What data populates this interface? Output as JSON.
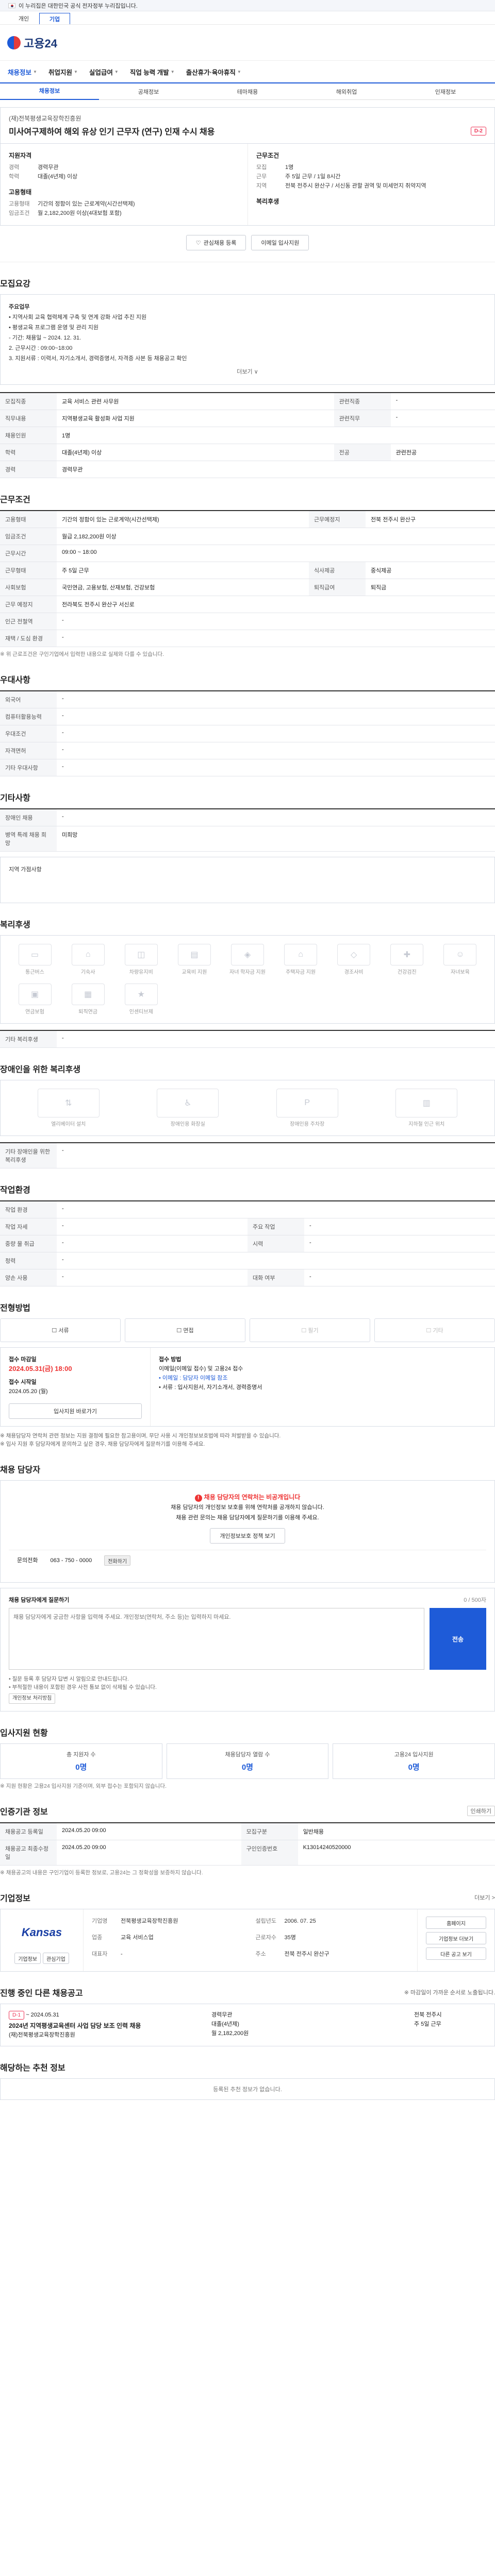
{
  "gov_banner": {
    "text": "이 누리집은 대한민국 공식 전자정부 누리집입니다."
  },
  "site_tabs": [
    {
      "label": "개인"
    },
    {
      "label": "기업"
    }
  ],
  "logo": {
    "text": "고용24"
  },
  "nav": [
    {
      "label": "채용정보"
    },
    {
      "label": "취업지원"
    },
    {
      "label": "실업급여"
    },
    {
      "label": "직업 능력 개발"
    },
    {
      "label": "출산휴가·육아휴직"
    }
  ],
  "subnav": [
    {
      "label": "채용정보"
    },
    {
      "label": "공채정보"
    },
    {
      "label": "테마채용"
    },
    {
      "label": "해외취업"
    },
    {
      "label": "인재정보"
    }
  ],
  "job": {
    "company": "(재)전북평생교육장학진흥원",
    "title": "미사여구제하여 해외 유상 인기 근무자 (연구) 인재 수시 채용",
    "dday": "D-2"
  },
  "summary": {
    "left_h1": "지원자격",
    "left_rows": [
      {
        "k": "경력",
        "v": "경력무관"
      },
      {
        "k": "학력",
        "v": "대졸(4년제) 이상"
      }
    ],
    "left_h2": "고용형태",
    "left_rows2": [
      {
        "k": "고용형태",
        "v": "기간의 정함이 있는 근로계약(시간선택제)"
      },
      {
        "k": "임금조건",
        "v": "월 2,182,200원 이상(4대보험 포함)"
      }
    ],
    "right_h1": "근무조건",
    "right_rows": [
      {
        "k": "모집",
        "v": "1명"
      },
      {
        "k": "근무",
        "v": "주 5일 근무 / 1일 8시간"
      },
      {
        "k": "지역",
        "v": "전북 전주시 완산구 / 서신동 관할 권역 및 미세먼지 취약지역"
      }
    ],
    "right_h2": "복리후생",
    "right_rows2": []
  },
  "actions": {
    "favorite": "관심채용 등록",
    "apply": "이메일 입사지원"
  },
  "sections": {
    "recruit": "모집요강",
    "conditions": "근무조건",
    "qualifications": "우대사항",
    "other": "기타사항",
    "welfare": "복리후생",
    "disability": "장애인을 위한 복리후생",
    "benefits": "기타 복리후생",
    "env": "작업환경",
    "process": "전형방법",
    "contact": "채용 담당자",
    "inquiry": "채용 담당자에게 질문하기",
    "status": "입사지원 현황",
    "info": "인증기관 정보",
    "company": "기업정보",
    "other_jobs": "진행 중인 다른 채용공고",
    "similar": "해당하는 추천 정보"
  },
  "recruit_box": {
    "heading": "주요업무",
    "lines": [
      "• 지역사회 교육 협력체계 구축 및 연계 강화 사업 추진 지원",
      "• 평생교육 프로그램 운영 및 관리 지원",
      "- 기간: 채용일 ~ 2024. 12. 31.",
      "2. 근무시간 : 09:00~18:00",
      "3. 지원서류 : 이력서, 자기소개서, 경력증명서, 자격증 사본 등 채용공고 확인"
    ],
    "more": "더보기 ∨"
  },
  "conditions_table": [
    {
      "k": "모집직종",
      "v": "교육 서비스 관련 사무원",
      "k2": "관련직종",
      "v2": "-"
    },
    {
      "k": "직무내용",
      "v": "지역평생교육 활성화 사업 지원",
      "k2": "관련직무",
      "v2": "-"
    },
    {
      "k": "채용인원",
      "v": "1명",
      "k2": "",
      "v2": ""
    },
    {
      "k": "학력",
      "v": "대졸(4년제) 이상",
      "k2": "전공",
      "v2": "관련전공"
    },
    {
      "k": "경력",
      "v": "경력무관",
      "k2": "",
      "v2": ""
    }
  ],
  "work_table": [
    {
      "k": "고용형태",
      "v": "기간의 정함이 있는 근로계약(시간선택제)",
      "k2": "근무예정지",
      "v2": "전북 전주시 완산구"
    },
    {
      "k": "임금조건",
      "v": "월급 2,182,200원 이상",
      "k2": "",
      "v2": ""
    },
    {
      "k": "근무시간",
      "v": "09:00 ~ 18:00",
      "k2": "",
      "v2": ""
    },
    {
      "k": "근무형태",
      "v": "주 5일 근무",
      "k2": "식사제공",
      "v2": "중식제공"
    },
    {
      "k": "사회보험",
      "v": "국민연금, 고용보험, 산재보험, 건강보험",
      "k2": "퇴직급여",
      "v2": "퇴직금"
    },
    {
      "k": "근무 예정지",
      "v": "전라북도 전주시 완산구 서신로",
      "k2": "",
      "v2": ""
    },
    {
      "k": "인근 전철역",
      "v": "-",
      "k2": "",
      "v2": ""
    },
    {
      "k": "재택 / 도심 환경",
      "v": "-",
      "k2": "",
      "v2": ""
    }
  ],
  "work_note": "※ 위 근로조건은 구인기업에서 입력한 내용으로 실제와 다를 수 있습니다.",
  "qual_table": [
    {
      "k": "외국어",
      "v": "-"
    },
    {
      "k": "컴퓨터활용능력",
      "v": "-"
    },
    {
      "k": "우대조건",
      "v": "-"
    },
    {
      "k": "자격면허",
      "v": "-"
    },
    {
      "k": "기타 우대사항",
      "v": "-"
    }
  ],
  "other_table": [
    {
      "k": "장애인 채용",
      "v": "-"
    },
    {
      "k": "병역 특례 채용 희망",
      "v": "미희망"
    }
  ],
  "other_note": "지역 가점사항",
  "welfare_items": [
    "통근버스",
    "기숙사",
    "차량유지비",
    "교육비 지원",
    "자녀 학자금 지원",
    "주택자금 지원",
    "경조사비",
    "건강검진",
    "자녀보육"
  ],
  "welfare_items2": [
    "연금보험",
    "퇴직연금",
    "인센티브제"
  ],
  "benefits_table": [
    {
      "k": "기타 복리후생",
      "v": "-"
    }
  ],
  "disability_items": [
    "엘리베이터 설치",
    "장애인용 화장실",
    "장애인용 주차장",
    "지하철 인근 위치"
  ],
  "disability_table": [
    {
      "k": "기타 장애인을 위한 복리후생",
      "v": "-"
    }
  ],
  "env_table": [
    {
      "k": "작업 환경",
      "v": "-",
      "k2": "",
      "v2": ""
    },
    {
      "k": "작업 자세",
      "v": "-",
      "k2": "주요 작업",
      "v2": "-"
    },
    {
      "k": "중량 물 취급",
      "v": "-",
      "k2": "시력",
      "v2": "-"
    },
    {
      "k": "청력",
      "v": "-",
      "k2": "",
      "v2": ""
    },
    {
      "k": "양손 사용",
      "v": "-",
      "k2": "대화 여부",
      "v2": "-"
    }
  ],
  "process_steps": [
    {
      "label": "서류",
      "off": false
    },
    {
      "label": "면접",
      "off": false
    },
    {
      "label": "필기",
      "off": true
    },
    {
      "label": "기타",
      "off": true
    }
  ],
  "apply": {
    "deadline_label": "접수 마감일",
    "deadline": "2024.05.31(금) 18:00",
    "period_label": "접수 시작일",
    "period": "2024.05.20 (월)",
    "method_label": "접수 방법",
    "method_lines": [
      "이메일(이메일 접수) 및 고용24 접수",
      "• 이메일 : 담당자 이메일 참조",
      "• 서류 : 입사지원서, 자기소개서, 경력증명서"
    ],
    "button": "입사지원 바로가기",
    "notes": [
      "※ 채용담당자 연락처 관련 정보는 지원 결정에 필요한 참고용이며, 무단 사용 시 개인정보보호법에 따라 처벌받을 수 있습니다.",
      "※ 입사 지원 후 담당자에게 문의하고 싶은 경우, 채용 담당자에게 질문하기를 이용해 주세요."
    ]
  },
  "contact": {
    "alert": "채용 담당자의 연락처는 비공개입니다",
    "lines": [
      "채용 담당자의 개인정보 보호를 위해 연락처를 공개하지 않습니다.",
      "채용 관련 문의는 채용 담당자에게 질문하기를 이용해 주세요."
    ],
    "btn": "개인정보보호 정책 보기",
    "row_label": "문의전화",
    "row_value": "063 - 750 - 0000",
    "row_btn": "전화하기"
  },
  "inquiry": {
    "guide": "채용 담당자에게 질문하기",
    "counter": "0 / 500자",
    "placeholder": "채용 담당자에게 궁금한 사항을 입력해 주세요. 개인정보(연락처, 주소 등)는 입력하지 마세요.",
    "send": "전송",
    "notes": [
      "• 질문 등록 후 담당자 답변 시 알림으로 안내드립니다.",
      "• 부적절한 내용이 포함된 경우 사전 통보 없이 삭제될 수 있습니다."
    ],
    "note_btn": "개인정보 처리방침"
  },
  "status": [
    {
      "label": "총 지원자 수",
      "value": "0명"
    },
    {
      "label": "채용담당자 열람 수",
      "value": "0명"
    },
    {
      "label": "고용24 입사지원",
      "value": "0명"
    }
  ],
  "status_note": "※ 지원 현황은 고용24 입사지원 기준이며, 외부 접수는 포함되지 않습니다.",
  "info_table": [
    {
      "k": "채용공고 등록일",
      "v": "2024.05.20 09:00",
      "k2": "모집구분",
      "v2": "일반채용"
    },
    {
      "k": "채용공고 최종수정일",
      "v": "2024.05.20 09:00",
      "k2": "구인인증번호",
      "v2": "K13014240520000"
    }
  ],
  "info_note": "※ 채용공고의 내용은 구인기업이 등록한 정보로, 고용24는 그 정확성을 보증하지 않습니다.",
  "info_btn": "인쇄하기",
  "company": {
    "logo_text": "Kansas",
    "btn1": "기업정보",
    "btn2": "관심기업",
    "rows": [
      {
        "k": "기업명",
        "v": "전북평생교육장학진흥원"
      },
      {
        "k": "설립년도",
        "v": "2006. 07. 25"
      },
      {
        "k": "업종",
        "v": "교육 서비스업"
      },
      {
        "k": "근로자수",
        "v": "35명"
      },
      {
        "k": "대표자",
        "v": "-"
      },
      {
        "k": "주소",
        "v": "전북 전주시 완산구"
      }
    ],
    "actions": [
      "홈페이지",
      "기업정보 더보기",
      "다른 공고 보기"
    ],
    "more": "더보기 >"
  },
  "other_jobs": {
    "dday": "D-1",
    "date": "~ 2024.05.31",
    "title": "2024년 지역평생교육센터 사업 담당 보조 인력 채용",
    "company": "(재)전북평생교육장학진흥원",
    "info_lines": [
      "경력무관",
      "대졸(4년제)",
      "월 2,182,200원"
    ],
    "right_lines": [
      "전북 전주시",
      "주 5일 근무"
    ],
    "note": "※ 마감일이 가까운 순서로 노출됩니다."
  },
  "similar": {
    "empty": "등록된 추천 정보가 없습니다."
  }
}
